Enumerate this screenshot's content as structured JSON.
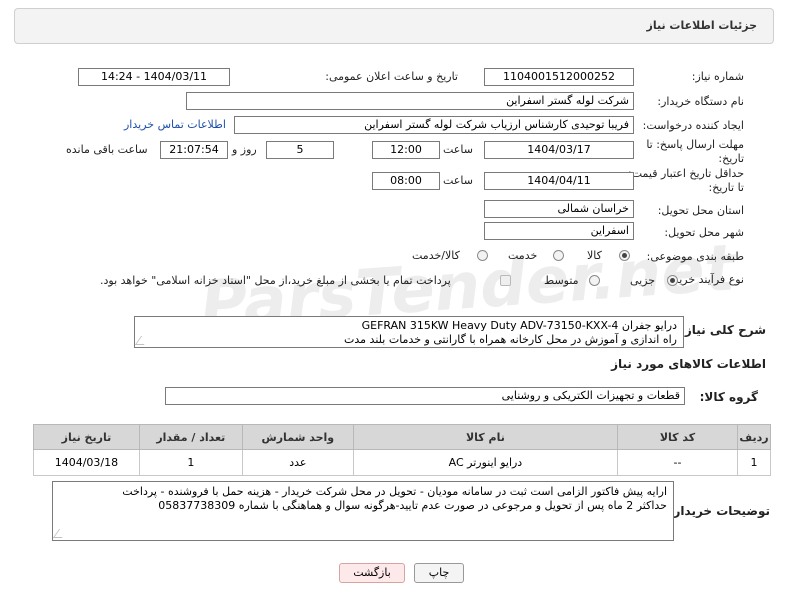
{
  "header": {
    "title": "جزئیات اطلاعات نیاز"
  },
  "form": {
    "need_number": {
      "label": "شماره نیاز:",
      "value": "1104001512000252"
    },
    "announce_datetime": {
      "label": "تاریخ و ساعت اعلان عمومی:",
      "value": "1404/03/11 - 14:24"
    },
    "buyer_org": {
      "label": "نام دستگاه خریدار:",
      "value": "شرکت لوله گستر اسفراین"
    },
    "requester": {
      "label": "ایجاد کننده درخواست:",
      "value": "فریبا توحیدی کارشناس ارزیاب شرکت لوله گستر اسفراین",
      "contact_link": "اطلاعات تماس خریدار"
    },
    "reply_deadline": {
      "label_line1": "مهلت ارسال پاسخ: تا",
      "label_line2": "تاریخ:",
      "date": "1404/03/17",
      "time_label": "ساعت",
      "time": "12:00",
      "days": "5",
      "days_label": "روز و",
      "remaining": "21:07:54",
      "remaining_label": "ساعت باقی مانده"
    },
    "price_validity": {
      "label_line1": "حداقل تاریخ اعتبار قیمت:",
      "label_line2": "تا تاریخ:",
      "date": "1404/04/11",
      "time_label": "ساعت",
      "time": "08:00"
    },
    "delivery_province": {
      "label": "استان محل تحویل:",
      "value": "خراسان شمالی"
    },
    "delivery_city": {
      "label": "شهر محل تحویل:",
      "value": "اسفراین"
    },
    "category": {
      "label": "طبقه بندی موضوعی:",
      "options": [
        "کالا",
        "خدمت",
        "کالا/خدمت"
      ],
      "selected": "کالا"
    },
    "process_type": {
      "label": "نوع فرآیند خرید :",
      "options": [
        "جزیی",
        "متوسط"
      ],
      "selected": "جزیی",
      "payment_note": "پرداخت تمام یا بخشی از مبلغ خرید،از محل \"اسناد خزانه اسلامی\" خواهد بود."
    }
  },
  "description": {
    "label": "شرح کلی نیاز:",
    "line1": "درایو جفران GEFRAN 315KW Heavy Duty   ADV-73150-KXX-4",
    "line2": "راه اندازی و آموزش  در محل کارخانه همراه با گارانتی و خدمات بلند مدت"
  },
  "goods_info": {
    "title": "اطلاعات کالاهای مورد نیاز"
  },
  "goods_group": {
    "label": "گروه کالا:",
    "value": "قطعات و تجهیزات الکتریکی و روشنایی"
  },
  "table": {
    "headers": [
      "ردیف",
      "کد کالا",
      "نام کالا",
      "واحد شمارش",
      "تعداد / مقدار",
      "تاریخ نیاز"
    ],
    "rows": [
      [
        "1",
        "--",
        "درایو اینورتر AC",
        "عدد",
        "1",
        "1404/03/18"
      ]
    ]
  },
  "buyer_notes": {
    "label": "توضیحات خریدار:",
    "line1": "ارایه پیش فاکتور الزامی است ثبت در سامانه مودیان - تحویل در محل شرکت خریدار - هزینه حمل با فروشنده - پرداخت",
    "line2": "حداکثر 2 ماه پس از تحویل و مرجوعی در صورت عدم تایید-هرگونه سوال و هماهنگی با شماره 05837738309"
  },
  "buttons": {
    "print": "چاپ",
    "back": "بازگشت"
  },
  "watermark": {
    "text": "ParsTender.net"
  }
}
